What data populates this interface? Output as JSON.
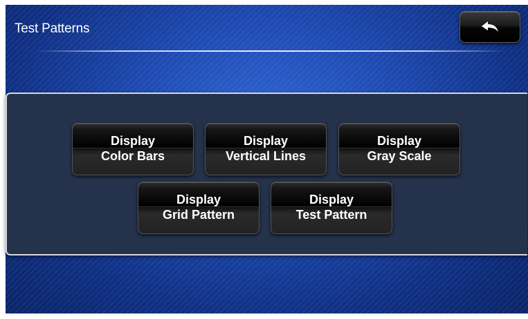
{
  "header": {
    "title": "Test Patterns",
    "back_icon": "back-arrow-icon"
  },
  "buttons": [
    {
      "line1": "Display",
      "line2": "Color Bars"
    },
    {
      "line1": "Display",
      "line2": "Vertical Lines"
    },
    {
      "line1": "Display",
      "line2": "Gray Scale"
    },
    {
      "line1": "Display",
      "line2": "Grid Pattern"
    },
    {
      "line1": "Display",
      "line2": "Test Pattern"
    }
  ],
  "colors": {
    "background": "#1d49b0",
    "panel": "#24324c",
    "button": "#000000",
    "text": "#ffffff"
  }
}
